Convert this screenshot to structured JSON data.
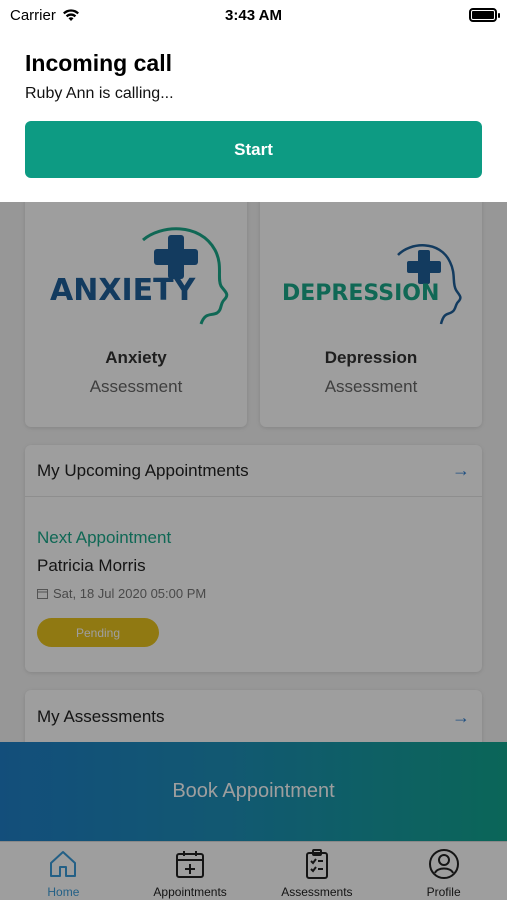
{
  "status_bar": {
    "carrier": "Carrier",
    "time": "3:43 AM",
    "icons": [
      "wifi-icon",
      "battery-icon"
    ]
  },
  "incoming_call": {
    "title": "Incoming call",
    "message": "Ruby Ann is calling...",
    "start_label": "Start"
  },
  "assessments": [
    {
      "logo_text": "ANXIETY",
      "title": "Anxiety",
      "subtitle": "Assessment"
    },
    {
      "logo_text": "DEPRESSION",
      "title": "Depression",
      "subtitle": "Assessment"
    }
  ],
  "upcoming": {
    "title": "My Upcoming Appointments",
    "next_label": "Next Appointment",
    "patient": "Patricia Morris",
    "date": "Sat, 18 Jul 2020 05:00 PM",
    "status": "Pending"
  },
  "my_assessments": {
    "title": "My Assessments"
  },
  "book_label": "Book Appointment",
  "tabs": [
    {
      "label": "Home",
      "icon": "home-icon",
      "active": true
    },
    {
      "label": "Appointments",
      "icon": "calendar-plus-icon",
      "active": false
    },
    {
      "label": "Assessments",
      "icon": "clipboard-check-icon",
      "active": false
    },
    {
      "label": "Profile",
      "icon": "user-circle-icon",
      "active": false
    }
  ],
  "colors": {
    "accent": "#0d9b83",
    "brand_blue": "#1f5f9a",
    "pending": "#e8c31d",
    "tab_active": "#3a9bd8"
  }
}
